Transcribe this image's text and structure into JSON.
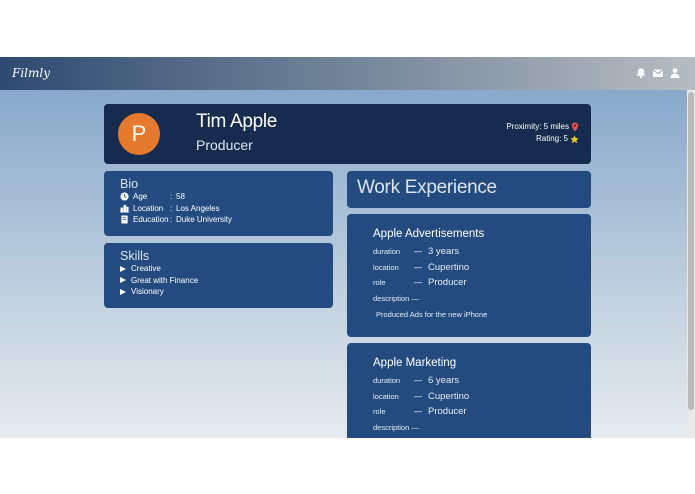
{
  "navbar": {
    "brand": "Filmly",
    "icons": [
      "bell-icon",
      "envelope-icon",
      "user-icon"
    ]
  },
  "profile": {
    "avatar_letter": "P",
    "name": "Tim Apple",
    "role": "Producer",
    "proximity": "Proximity: 5 miles",
    "rating": "Rating: 5",
    "avatar_color": "#e57a2f"
  },
  "bio": {
    "title": "Bio",
    "rows": [
      {
        "icon": "clock-icon",
        "label": "Age",
        "sep": ":",
        "value": "58"
      },
      {
        "icon": "city-icon",
        "label": "Location",
        "sep": ":",
        "value": "Los Angeles"
      },
      {
        "icon": "book-icon",
        "label": "Education",
        "sep": ":",
        "value": "Duke University"
      }
    ]
  },
  "skills": {
    "title": "Skills",
    "items": [
      "Creative",
      "Great with Finance",
      "Visionary"
    ]
  },
  "work": {
    "title": "Work Experience",
    "jobs": [
      {
        "title": "Apple Advertisements",
        "duration_label": "duration",
        "duration": "3 years",
        "location_label": "location",
        "location": "Cupertino",
        "role_label": "role",
        "role": "Producer",
        "description_label": "description —",
        "description": "Produced Ads for the new iPhone"
      },
      {
        "title": "Apple Marketing",
        "duration_label": "duration",
        "duration": "6 years",
        "location_label": "location",
        "location": "Cupertino",
        "role_label": "role",
        "role": "Producer",
        "description_label": "description —",
        "description": ""
      }
    ]
  },
  "dash": "—",
  "colors": {
    "card_dark": "#162b4d",
    "card_blue": "#234b80",
    "accent_orange": "#e57a2f",
    "pin_red": "#d9534f",
    "star_yellow": "#f0c419"
  }
}
